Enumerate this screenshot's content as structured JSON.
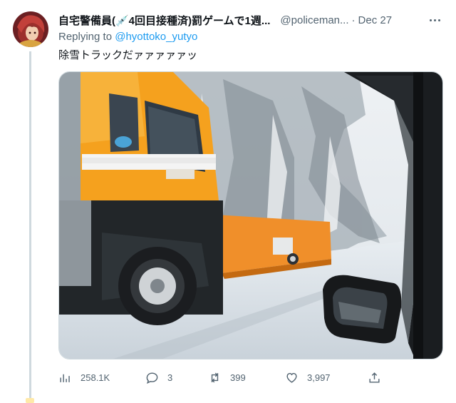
{
  "tweet": {
    "display_name": "自宅警備員(💉4回目接種済)罰ゲームで1週...",
    "handle": "@policeman...",
    "separator": "·",
    "date": "Dec 27",
    "replying_prefix": "Replying to ",
    "replying_to": "@hyottoko_yutyo",
    "text": "除雪トラックだァァァァァッ"
  },
  "media": {
    "icon": "photo-snowplow-truck"
  },
  "actions": {
    "views": "258.1K",
    "replies": "3",
    "retweets": "399",
    "likes": "3,997"
  },
  "colors": {
    "link": "#1d9bf0",
    "muted": "#536471",
    "text": "#0f1419",
    "border": "#cfd9de"
  }
}
